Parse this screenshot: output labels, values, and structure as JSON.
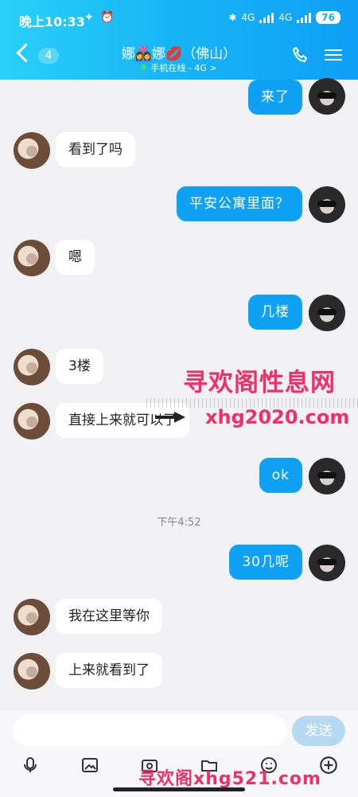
{
  "status": {
    "time": "晚上10:33",
    "icons": "✦ ⏰",
    "signal_a": "4G",
    "signal_b": "4G",
    "battery": "76"
  },
  "header": {
    "unread_count": "4",
    "contact_name": "娜👩‍❤️‍👩娜💋（佛山）",
    "status_text": "手机在线 - 4G >"
  },
  "messages": [
    {
      "side": "out",
      "text": "来了"
    },
    {
      "side": "in",
      "text": "看到了吗"
    },
    {
      "side": "out",
      "text": "平安公寓里面？"
    },
    {
      "side": "in",
      "text": "嗯"
    },
    {
      "side": "out",
      "text": "几楼"
    },
    {
      "side": "in",
      "text": "3楼"
    },
    {
      "side": "in",
      "text": "直接上来就可以了"
    },
    {
      "side": "out",
      "text": "ok"
    },
    {
      "side": "time",
      "text": "下午4:52"
    },
    {
      "side": "out",
      "text": "30几呢"
    },
    {
      "side": "in",
      "text": "我在这里等你"
    },
    {
      "side": "in",
      "text": "上来就看到了"
    }
  ],
  "watermark": {
    "line1": "寻欢阁性息网",
    "line2": "xhg2020.com",
    "bottom": "寻欢阁xhg521.com"
  },
  "input": {
    "placeholder": "",
    "send_label": "发送"
  },
  "toolbar": {
    "items": [
      "microphone-icon",
      "image-icon",
      "camera-icon",
      "folder-icon",
      "emoji-icon",
      "plus-icon"
    ]
  },
  "colors": {
    "header_start": "#2ad1f7",
    "header_end": "#0f9ff4",
    "bubble_out": "#0ea1f4",
    "bubble_in": "#ffffff",
    "watermark": "#ef2f67"
  }
}
